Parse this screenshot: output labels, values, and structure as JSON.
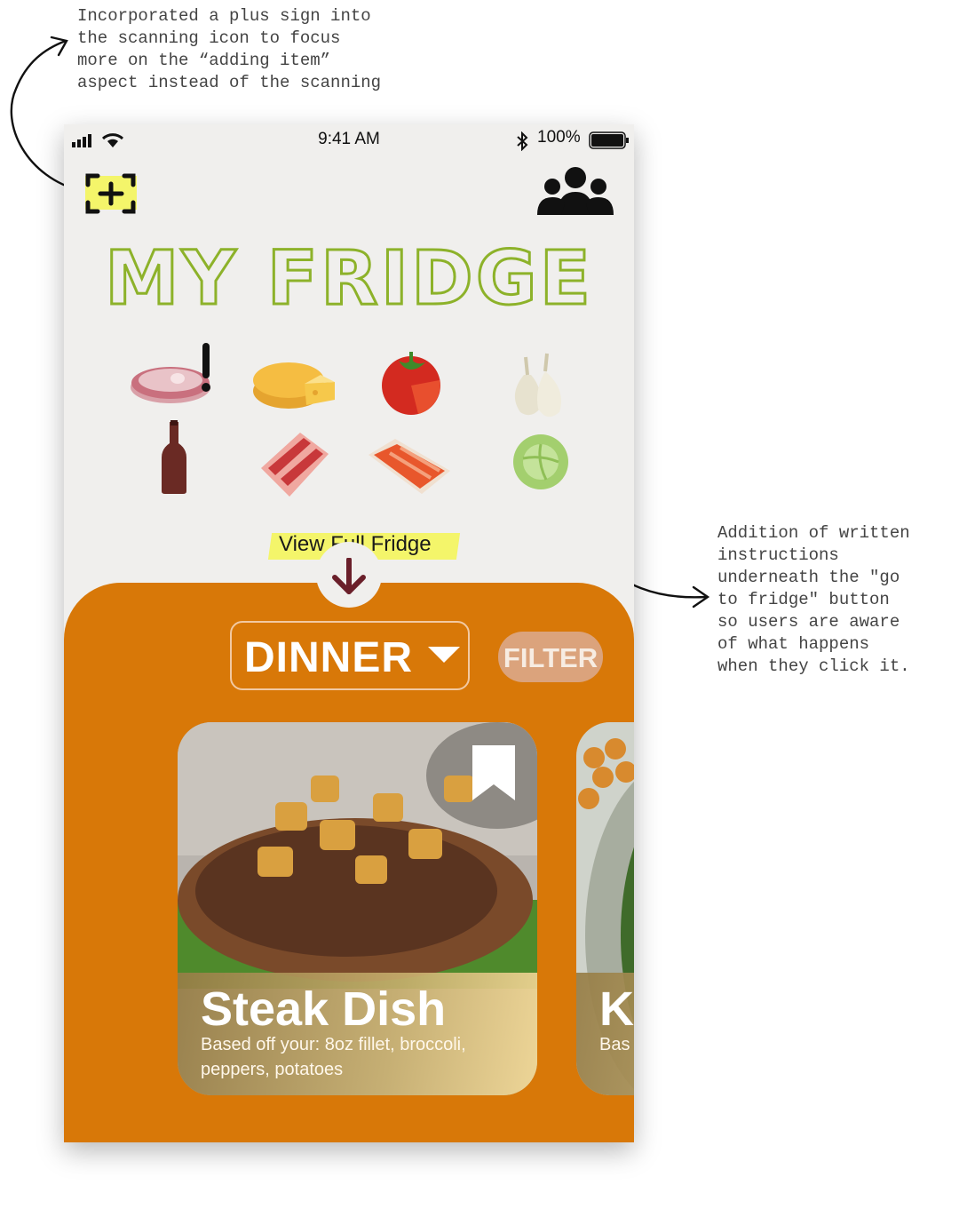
{
  "annotations": {
    "top_note": "Incorporated a plus sign into\nthe scanning icon to focus\nmore on the “adding item”\naspect instead of the scanning",
    "right_note": "Addition of written\ninstructions\nunderneath the \"go\nto fridge\" button\nso users are aware\nof what happens\nwhen they click it."
  },
  "status_bar": {
    "time": "9:41 AM",
    "battery": "100%"
  },
  "header": {
    "title": "MY FRIDGE",
    "scan_icon": "scan-add-icon",
    "profile_icon": "group-icon"
  },
  "fridge": {
    "items": [
      "steak-icon",
      "cheese-icon",
      "tomato-icon",
      "garlic-icon",
      "wine-bottle-icon",
      "bacon-icon",
      "salmon-icon",
      "cabbage-icon"
    ],
    "alert_item": "steak-icon",
    "view_full_label": "View Full Fridge"
  },
  "recipes": {
    "meal": "DINNER",
    "filter_label": "FILTER",
    "cards": [
      {
        "title": "Steak Dish",
        "subtitle": "Based off your: 8oz fillet, broccoli, peppers, potatoes"
      },
      {
        "title": "Ke",
        "subtitle": "Bas dre"
      }
    ]
  },
  "colors": {
    "accent_green": "#8db22a",
    "sheet_orange": "#d87808",
    "highlight_yellow": "#f4f56a",
    "filter_tan": "#dba37c"
  }
}
